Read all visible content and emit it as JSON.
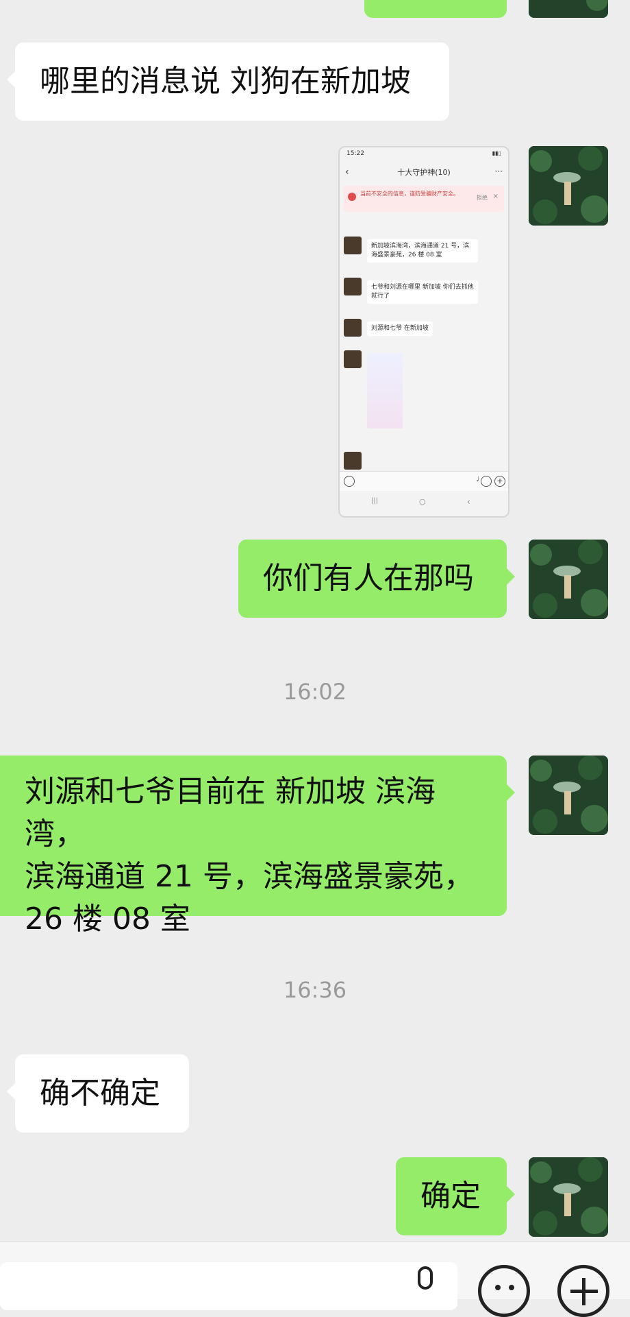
{
  "messages": [
    {
      "id": "m1",
      "side": "in",
      "text": "哪里的消息说 刘狗在新加坡"
    },
    {
      "id": "m2",
      "side": "out",
      "type": "image",
      "alt": "screenshot"
    },
    {
      "id": "m3",
      "side": "out",
      "text": "你们有人在那吗"
    },
    {
      "id": "t1",
      "type": "time",
      "text": "16:02"
    },
    {
      "id": "m4",
      "side": "out",
      "lines": [
        "刘源和七爷目前在 新加坡 滨海湾，",
        "滨海通道 21 号，滨海盛景豪苑，",
        "26 楼 08 室"
      ]
    },
    {
      "id": "t2",
      "type": "time",
      "text": "16:36"
    },
    {
      "id": "m5",
      "side": "in",
      "text": "确不确定"
    },
    {
      "id": "m6",
      "side": "out",
      "text": "确定"
    }
  ],
  "embedded_screenshot": {
    "status_time": "15:22",
    "title": "十大守护神(10)",
    "warning": "当前不安全的信息，谨防受骗财产安全。",
    "warning_action": "拒绝",
    "mini_messages": [
      "新加坡滨海湾，滨海通道 21 号，滨海盛景豪苑，26 楼 08 室",
      "七爷和刘源在哪里 新加坡 你们去抓他就行了",
      "刘源和七爷 在新加坡"
    ]
  },
  "icons": {
    "voice": "microphone-icon",
    "emoji": "emoji-icon",
    "more": "plus-icon"
  },
  "colors": {
    "background": "#ededed",
    "bubble_out": "#95ec69",
    "bubble_in": "#ffffff",
    "time_text": "#9a9a9a"
  }
}
